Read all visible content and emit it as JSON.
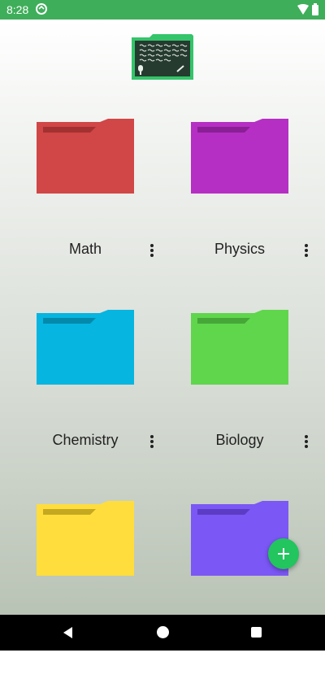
{
  "status_bar": {
    "time": "8:28"
  },
  "app": {
    "logo": "chalkboard-folder-icon"
  },
  "folders": [
    {
      "label": "Math",
      "color": "#d14646",
      "tab": "#a33131"
    },
    {
      "label": "Physics",
      "color": "#b62fc4",
      "tab": "#8a1f96"
    },
    {
      "label": "Chemistry",
      "color": "#06b5e0",
      "tab": "#0589ab"
    },
    {
      "label": "Biology",
      "color": "#5fd64c",
      "tab": "#46a738"
    },
    {
      "label": "",
      "color": "#ffdd3d",
      "tab": "#c4a821"
    },
    {
      "label": "",
      "color": "#7b57f5",
      "tab": "#5b3cc4"
    }
  ],
  "fab": {
    "icon": "plus-icon",
    "color": "#22c55e"
  },
  "nav": {
    "back": "back-icon",
    "home": "home-icon",
    "recents": "recents-icon"
  }
}
